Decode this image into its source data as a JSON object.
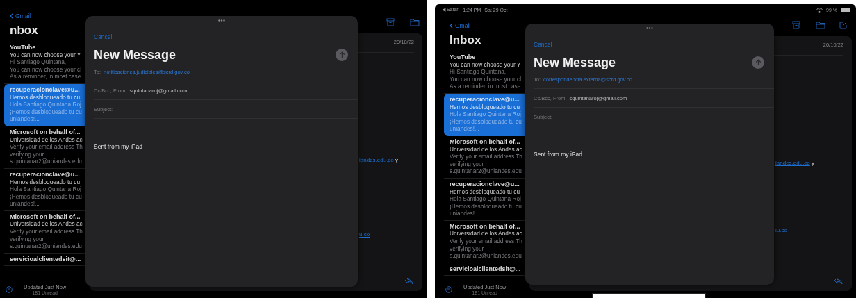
{
  "screens": [
    {
      "nav": {
        "back_label": "Gmail"
      },
      "title": "nbox",
      "messages": [
        {
          "sender": "YouTube",
          "subject": "You can now choose your Y",
          "preview_lines": [
            "Hi Santiago Quintana,",
            "You can now choose your cl",
            "As a reminder, in most case"
          ],
          "selected": false
        },
        {
          "sender": "recuperacionclave@u...",
          "subject": "Hemos desbloqueado tu cu",
          "preview_lines": [
            "Hola Santiago Quintana Roj",
            "¡Hemos desbloqueado tu cu",
            "uniandes!..."
          ],
          "selected": true
        },
        {
          "sender": "Microsoft on behalf of...",
          "subject": "Universidad de los Andes ac",
          "preview_lines": [
            "Verify your email address Th",
            "verifying your",
            "s.quintanar2@uniandes.edu"
          ],
          "selected": false
        },
        {
          "sender": "recuperacionclave@u...",
          "subject": "Hemos desbloqueado tu cu",
          "preview_lines": [
            "Hola Santiago Quintana Roj",
            "¡Hemos desbloqueado tu cu",
            "uniandes!..."
          ],
          "selected": false
        },
        {
          "sender": "Microsoft on behalf of...",
          "subject": "Universidad de los Andes ac",
          "preview_lines": [
            "Verify your email address Th",
            "verifying your",
            "s.quintanar2@uniandes.edu"
          ],
          "selected": false
        },
        {
          "sender": "servicioalclientedsit@...",
          "selected": false
        }
      ],
      "footer": {
        "updated": "Updated Just Now",
        "unread": "181 Unread"
      },
      "toolbar": [
        {
          "kind": "archive"
        },
        {
          "kind": "folder"
        }
      ],
      "detail": {
        "date": "20/10/22",
        "link_lines": [
          {
            "link": "iandes.edu.co",
            "tail": "y"
          },
          {
            "link": "u.co"
          }
        ]
      },
      "compose": {
        "cancel": "Cancel",
        "title": "New Message",
        "send_enabled": false,
        "to_label": "To:",
        "to": "notificaciones.judiciales@scrd.gov.co",
        "from_label": "Cc/Bcc, From:",
        "from": "squintanaroj@gmail.com",
        "subject_label": "Subject:",
        "body": "Sent from my iPad"
      }
    },
    {
      "status_bar": {
        "back_app": "◀ Safari",
        "time": "1:24 PM",
        "date": "Sat 29 Oct",
        "battery": "99 %"
      },
      "nav": {
        "back_label": "Gmail"
      },
      "title": "Inbox",
      "messages": [
        {
          "sender": "YouTube",
          "subject": "You can now choose your Y",
          "preview_lines": [
            "Hi Santiago Quintana,",
            "You can now choose your cl",
            "As a reminder, in most case"
          ],
          "selected": false
        },
        {
          "sender": "recuperacionclave@u...",
          "subject": "Hemos desbloqueado tu cu",
          "preview_lines": [
            "Hola Santiago Quintana Roj",
            "¡Hemos desbloqueado tu cu",
            "uniandes!..."
          ],
          "selected": true
        },
        {
          "sender": "Microsoft on behalf of...",
          "subject": "Universidad de los Andes ac",
          "preview_lines": [
            "Verify your email address Th",
            "verifying your",
            "s.quintanar2@uniandes.edu"
          ],
          "selected": false
        },
        {
          "sender": "recuperacionclave@u...",
          "subject": "Hemos desbloqueado tu cu",
          "preview_lines": [
            "Hola Santiago Quintana Roj",
            "¡Hemos desbloqueado tu cu",
            "uniandes!..."
          ],
          "selected": false
        },
        {
          "sender": "Microsoft on behalf of...",
          "subject": "Universidad de los Andes ac",
          "preview_lines": [
            "Verify your email address Th",
            "verifying your",
            "s.quintanar2@uniandes.edu"
          ],
          "selected": false
        },
        {
          "sender": "servicioalclientedsit@...",
          "selected": false
        }
      ],
      "footer": {
        "updated": "Updated Just Now",
        "unread": "181 Unread"
      },
      "toolbar": [
        {
          "kind": "archive"
        },
        {
          "kind": "folder"
        },
        {
          "kind": "compose"
        }
      ],
      "detail": {
        "date": "20/10/22",
        "link_lines": [
          {
            "link": "iandes.edu.co",
            "tail": "y"
          },
          {
            "link": "lu.co"
          }
        ]
      },
      "compose": {
        "cancel": "Cancel",
        "title": "New Message",
        "send_enabled": false,
        "to_label": "To:",
        "to": "correspondencia.externa@scrd.gov.co",
        "from_label": "Cc/Bcc, From:",
        "from": "squintanaroj@gmail.com",
        "subject_label": "Subject:",
        "body": "Sent from my iPad"
      }
    }
  ]
}
